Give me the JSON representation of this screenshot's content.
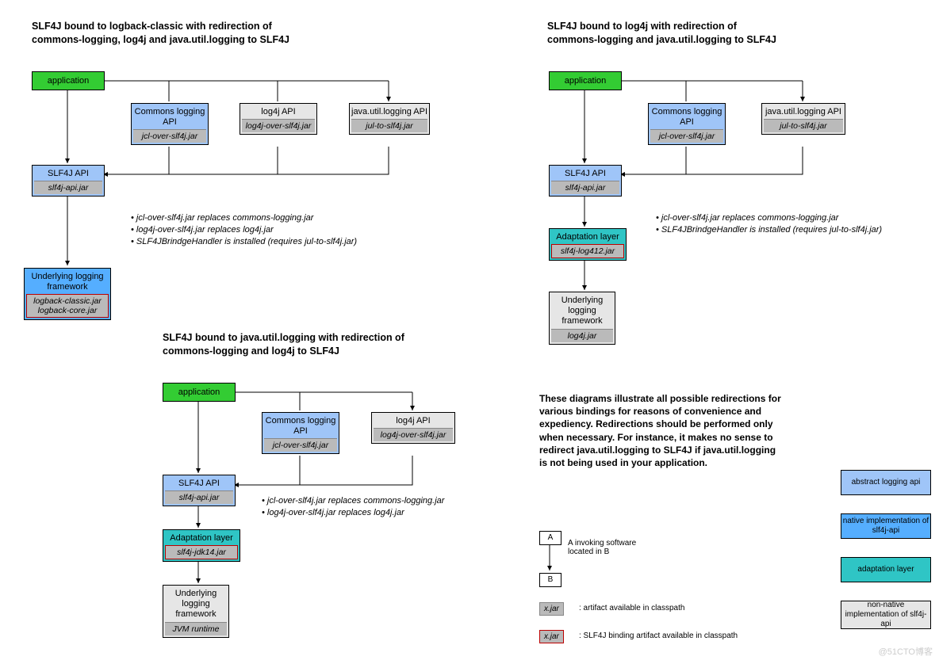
{
  "diagram1": {
    "title": "SLF4J bound to logback-classic with redirection of commons-logging, log4j and java.util.logging to SLF4J",
    "app": "application",
    "commons": "Commons logging API",
    "commons_jar": "jcl-over-slf4j.jar",
    "log4j": "log4j API",
    "log4j_jar": "log4j-over-slf4j.jar",
    "jul": "java.util.logging API",
    "jul_jar": "jul-to-slf4j.jar",
    "slf4j": "SLF4J API",
    "slf4j_jar": "slf4j-api.jar",
    "underlying": "Underlying logging framework",
    "underlying_jar": "logback-classic.jar logback-core.jar",
    "notes": "• jcl-over-slf4j.jar replaces commons-logging.jar\n• log4j-over-slf4j.jar replaces log4j.jar\n• SLF4JBrindgeHandler is installed (requires jul-to-slf4j.jar)"
  },
  "diagram2": {
    "title": "SLF4J bound to log4j with redirection of commons-logging and java.util.logging to SLF4J",
    "app": "application",
    "commons": "Commons logging API",
    "commons_jar": "jcl-over-slf4j.jar",
    "jul": "java.util.logging API",
    "jul_jar": "jul-to-slf4j.jar",
    "slf4j": "SLF4J API",
    "slf4j_jar": "slf4j-api.jar",
    "adapt": "Adaptation layer",
    "adapt_jar": "slf4j-log412.jar",
    "underlying": "Underlying logging framework",
    "underlying_jar": "log4j.jar",
    "notes": "• jcl-over-slf4j.jar replaces commons-logging.jar\n• SLF4JBrindgeHandler is installed (requires jul-to-slf4j.jar)"
  },
  "diagram3": {
    "title": "SLF4J bound to java.util.logging with redirection of commons-logging and log4j to SLF4J",
    "app": "application",
    "commons": "Commons logging API",
    "commons_jar": "jcl-over-slf4j.jar",
    "log4j": "log4j API",
    "log4j_jar": "log4j-over-slf4j.jar",
    "slf4j": "SLF4J API",
    "slf4j_jar": "slf4j-api.jar",
    "adapt": "Adaptation layer",
    "adapt_jar": "slf4j-jdk14.jar",
    "underlying": "Underlying logging framework",
    "underlying_jar": "JVM runtime",
    "notes": "• jcl-over-slf4j.jar replaces commons-logging.jar\n• log4j-over-slf4j.jar replaces log4j.jar"
  },
  "explain": "These diagrams illustrate all possible redirections for various bindings for reasons of convenience and expediency. Redirections should be performed only when necessary. For instance, it makes no sense to redirect java.util.logging to SLF4J if java.util.logging is not being used in your application.",
  "legend": {
    "A": "A",
    "B": "B",
    "invoke": "A invoking software located in B",
    "xjar": "x.jar",
    "xjar_desc": ": artifact available in classpath",
    "xjar_red_desc": ": SLF4J binding artifact available in classpath",
    "abstract": "abstract logging api",
    "native": "native implementation of slf4j-api",
    "adapt": "adaptation layer",
    "nonnative": "non-native implementation of slf4j-api"
  },
  "watermark": "@51CTO博客"
}
